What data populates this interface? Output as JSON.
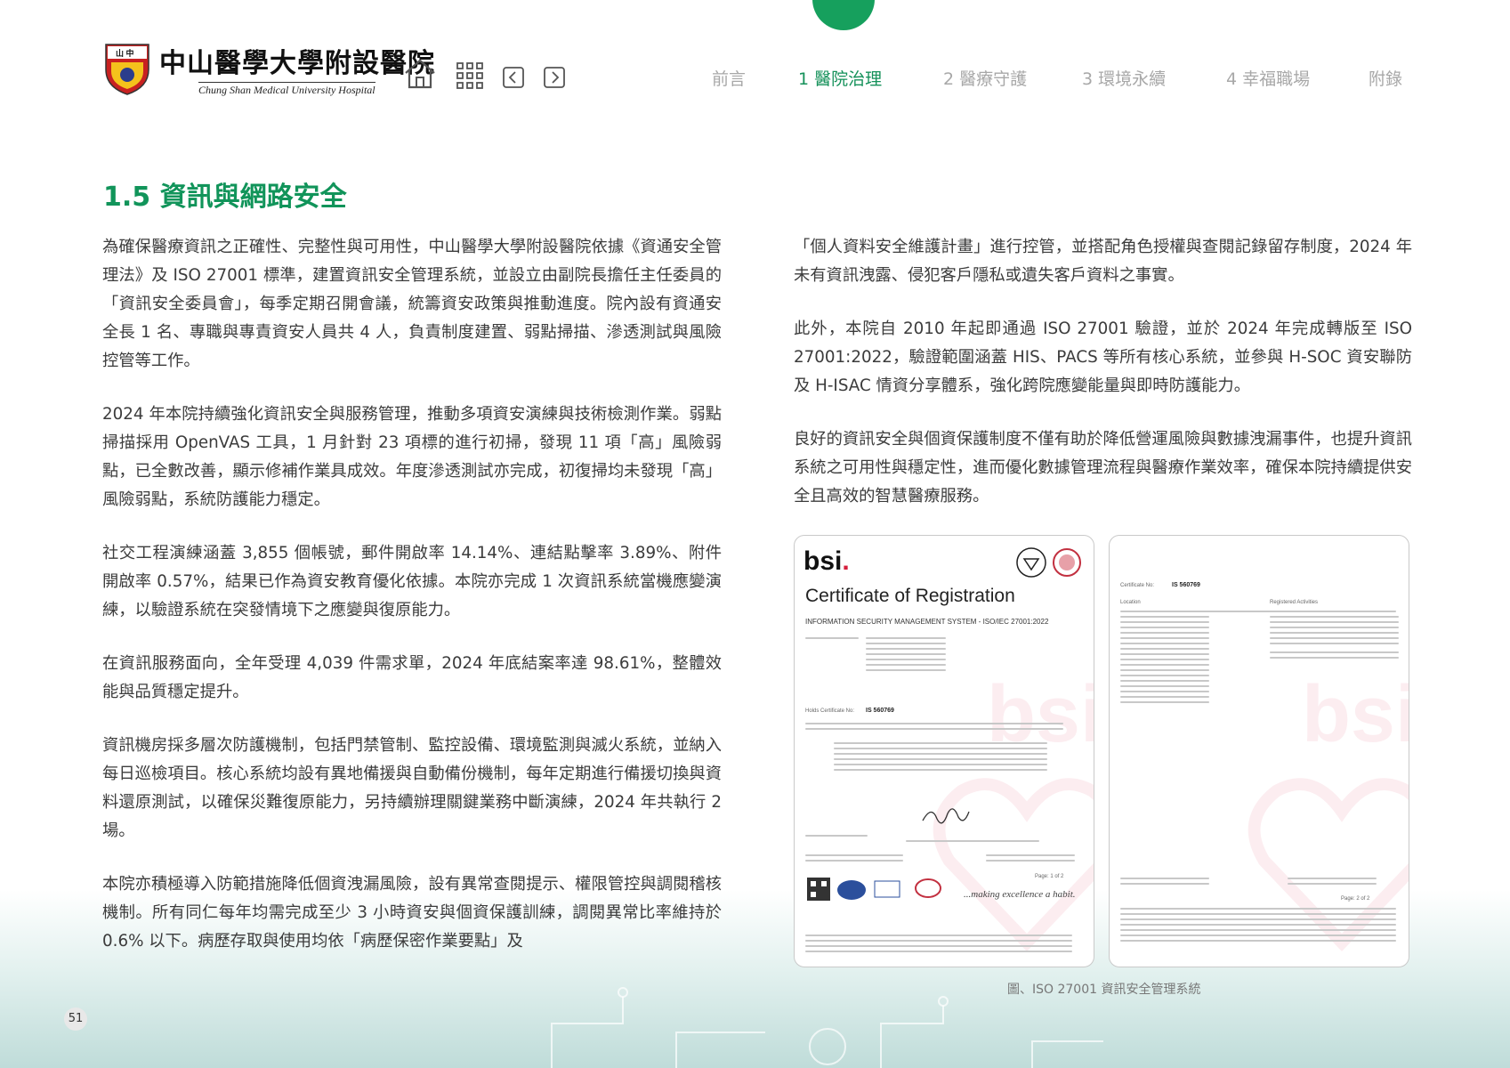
{
  "header": {
    "logo_cn": "中山醫學大學附設醫院",
    "logo_en": "Chung Shan Medical University Hospital",
    "crest_text": "山 中",
    "nav": [
      {
        "label": "前言"
      },
      {
        "label": "1 醫院治理"
      },
      {
        "label": "2 醫療守護"
      },
      {
        "label": "3 環境永續"
      },
      {
        "label": "4 幸福職場"
      },
      {
        "label": "附錄"
      }
    ],
    "active_nav_index": 1,
    "accent_color": "#16a05d",
    "toolbar_icons": [
      "home-icon",
      "grid-icon",
      "prev-page-icon",
      "next-page-icon"
    ]
  },
  "section": {
    "title": "1.5 資訊與網路安全"
  },
  "left_column": {
    "paragraphs": [
      "為確保醫療資訊之正確性、完整性與可用性，中山醫學大學附設醫院依據《資通安全管理法》及 ISO 27001 標準，建置資訊安全管理系統，並設立由副院長擔任主任委員的「資訊安全委員會」，每季定期召開會議，統籌資安政策與推動進度。院內設有資通安全長 1 名、專職與專責資安人員共 4 人，負責制度建置、弱點掃描、滲透測試與風險控管等工作。",
      "2024 年本院持續強化資訊安全與服務管理，推動多項資安演練與技術檢測作業。弱點掃描採用 OpenVAS 工具，1 月針對 23 項標的進行初掃，發現 11 項「高」風險弱點，已全數改善，顯示修補作業具成效。年度滲透測試亦完成，初復掃均未發現「高」風險弱點，系統防護能力穩定。",
      "社交工程演練涵蓋 3,855 個帳號，郵件開啟率 14.14%、連結點擊率 3.89%、附件開啟率 0.57%，結果已作為資安教育優化依據。本院亦完成 1 次資訊系統當機應變演練，以驗證系統在突發情境下之應變與復原能力。",
      "在資訊服務面向，全年受理 4,039 件需求單，2024 年底結案率達 98.61%，整體效能與品質穩定提升。",
      "資訊機房採多層次防護機制，包括門禁管制、監控設備、環境監測與滅火系統，並納入每日巡檢項目。核心系統均設有異地備援與自動備份機制，每年定期進行備援切換與資料還原測試，以確保災難復原能力，另持續辦理關鍵業務中斷演練，2024 年共執行 2 場。",
      "本院亦積極導入防範措施降低個資洩漏風險，設有異常查閱提示、權限管控與調閱稽核機制。所有同仁每年均需完成至少 3 小時資安與個資保護訓練，調閱異常比率維持於 0.6% 以下。病歷存取與使用均依「病歷保密作業要點」及"
    ]
  },
  "right_column": {
    "paragraphs": [
      "「個人資料安全維護計畫」進行控管，並搭配角色授權與查閱記錄留存制度，2024 年未有資訊洩露、侵犯客戶隱私或遺失客戶資料之事實。",
      "此外，本院自 2010 年起即通過 ISO 27001 驗證，並於 2024 年完成轉版至 ISO 27001:2022，驗證範圍涵蓋 HIS、PACS 等所有核心系統，並參與 H-SOC 資安聯防及 H-ISAC 情資分享體系，強化跨院應變能量與即時防護能力。",
      "良好的資訊安全與個資保護制度不僅有助於降低營運風險與數據洩漏事件，也提升資訊系統之可用性與穩定性，進而優化數據管理流程與醫療作業效率，確保本院持續提供安全且高效的智慧醫療服務。"
    ]
  },
  "certificate": {
    "brand": "bsi",
    "title": "Certificate of Registration",
    "subtitle": "INFORMATION SECURITY MANAGEMENT SYSTEM - ISO/IEC 27001:2022",
    "cert_no_label": "Holds Certificate No:",
    "cert_no": "IS 560769",
    "page2_cert_label": "Certificate No:",
    "location_label": "Location",
    "activities_label": "Registered Activities",
    "habit": "...making excellence a habit.",
    "page1": "Page: 1 of 2",
    "page2": "Page: 2 of 2"
  },
  "figure": {
    "caption": "圖、ISO 27001 資訊安全管理系統"
  },
  "footer": {
    "page_number": "51"
  }
}
